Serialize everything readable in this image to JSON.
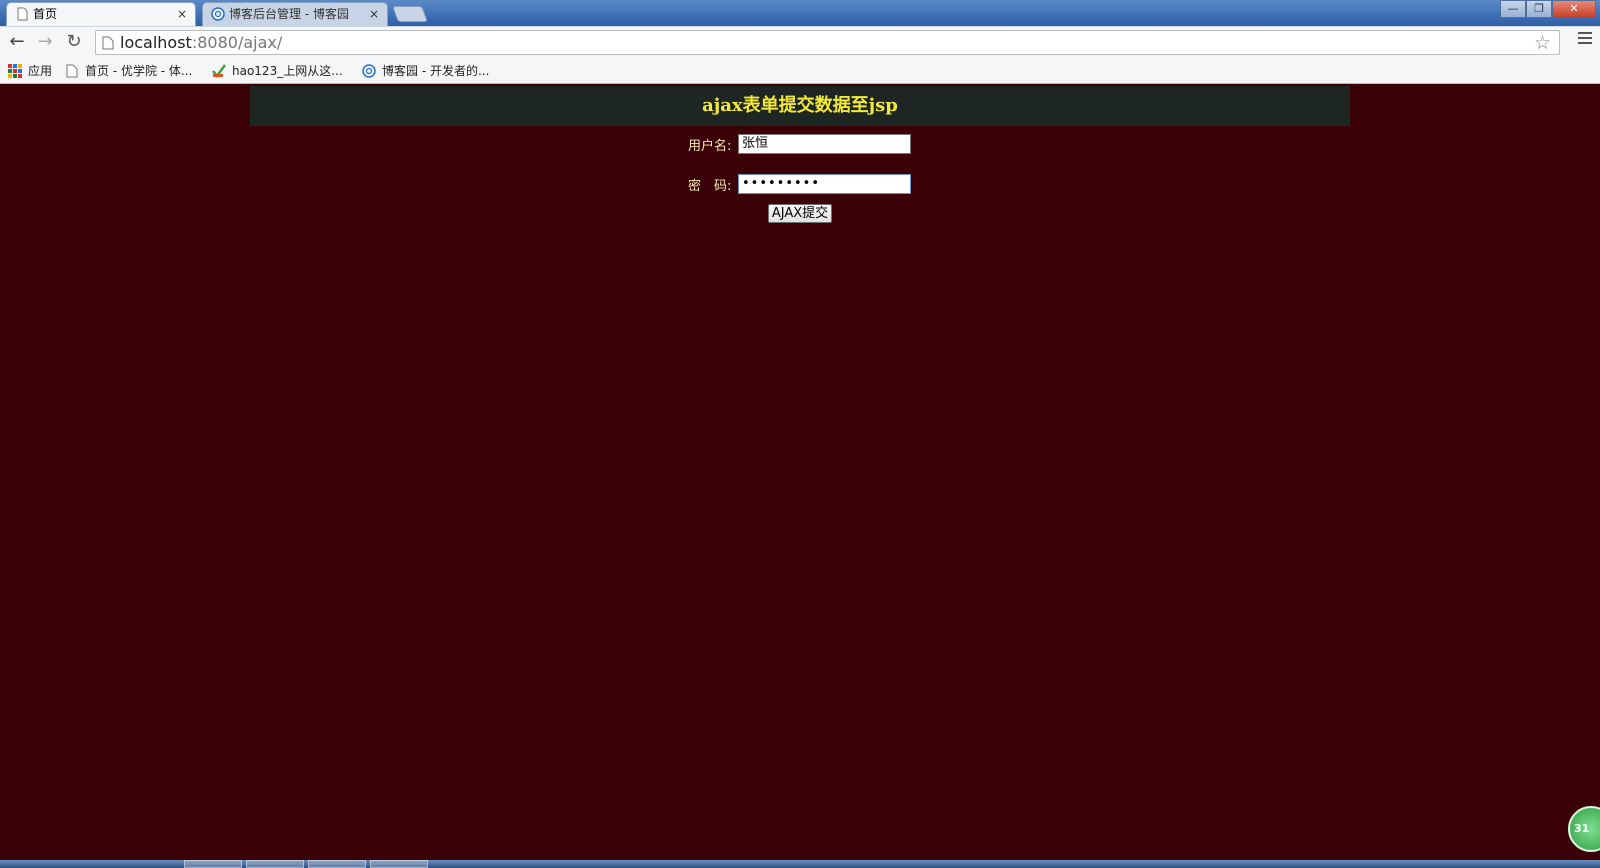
{
  "browser": {
    "tabs": [
      {
        "title": "首页",
        "active": true
      },
      {
        "title": "博客后台管理 - 博客园",
        "active": false
      }
    ],
    "tab_close_glyph": "×",
    "address": {
      "host": "localhost",
      "rest": ":8080/ajax/"
    },
    "bookmarks": [
      {
        "label": "应用",
        "icon": "apps-grid-icon"
      },
      {
        "label": "首页 - 优学院 - 体...",
        "icon": "page-icon"
      },
      {
        "label": "hao123_上网从这...",
        "icon": "hao123-icon"
      },
      {
        "label": "博客园 - 开发者的...",
        "icon": "cnblogs-icon"
      }
    ],
    "window_buttons": {
      "minimize": "—",
      "restore": "❐",
      "close": "✕"
    }
  },
  "page": {
    "title": "ajax表单提交数据至jsp",
    "username_label": "用户名:",
    "username_value": "张恒",
    "password_label": "密　码:",
    "password_value": "•••••••••",
    "submit_label": "AJAX提交"
  },
  "badge": {
    "text": "31"
  },
  "colors": {
    "page_bg": "#3a0206",
    "header_bg": "#1d2622",
    "title_color": "#f4e838",
    "label_color": "#f7e9b8"
  }
}
